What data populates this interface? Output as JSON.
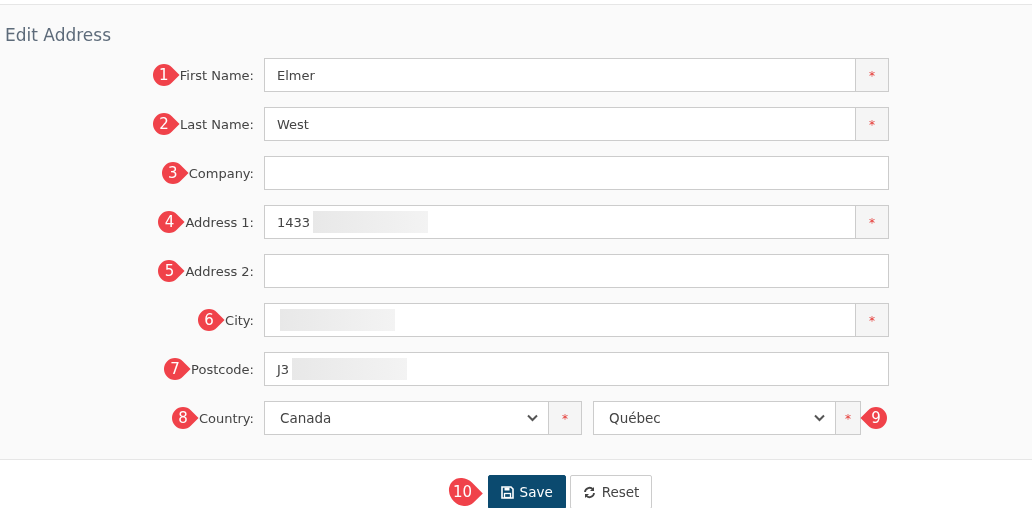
{
  "title": "Edit Address",
  "fields": [
    {
      "kind": "text",
      "callout": "1",
      "label": "First Name:",
      "value": "Elmer",
      "required_mark": "*"
    },
    {
      "kind": "text",
      "callout": "2",
      "label": "Last Name:",
      "value": "West",
      "required_mark": "*"
    },
    {
      "kind": "text",
      "callout": "3",
      "label": "Company:"
    },
    {
      "kind": "text",
      "callout": "4",
      "label": "Address 1:",
      "value": "1433",
      "redacted": true,
      "required_mark": "*"
    },
    {
      "kind": "text",
      "callout": "5",
      "label": "Address 2:"
    },
    {
      "kind": "text",
      "callout": "6",
      "label": "City:",
      "redacted": true,
      "required_mark": "*"
    },
    {
      "kind": "text",
      "callout": "7",
      "label": "Postcode:",
      "value": "J3",
      "redacted": true
    },
    {
      "kind": "select-pair",
      "callout": "8",
      "label": "Country:",
      "selects": [
        {
          "value": "Canada",
          "required_mark": "*"
        },
        {
          "value": "Québec",
          "required_mark": "*",
          "callout": "9"
        }
      ]
    }
  ],
  "buttons": [
    {
      "kind": "primary",
      "label": "Save",
      "callout": "10"
    },
    {
      "kind": "secondary",
      "label": "Reset"
    }
  ]
}
